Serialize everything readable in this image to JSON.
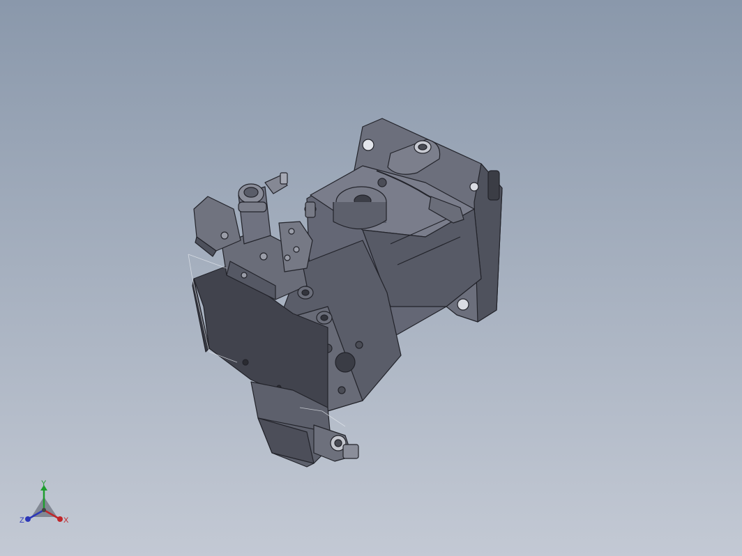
{
  "viewport": {
    "background_top": "#8a98ab",
    "background_bottom": "#c3c9d4",
    "model": {
      "body_color": "#5e616e",
      "light_color": "#7b7e8c",
      "dark_color": "#41434d",
      "edge_color": "#22232a"
    }
  },
  "triad": {
    "x_label": "X",
    "y_label": "Y",
    "z_label": "Z",
    "x_color": "#c0262a",
    "y_color": "#1e9e2e",
    "z_color": "#2c37b8"
  }
}
